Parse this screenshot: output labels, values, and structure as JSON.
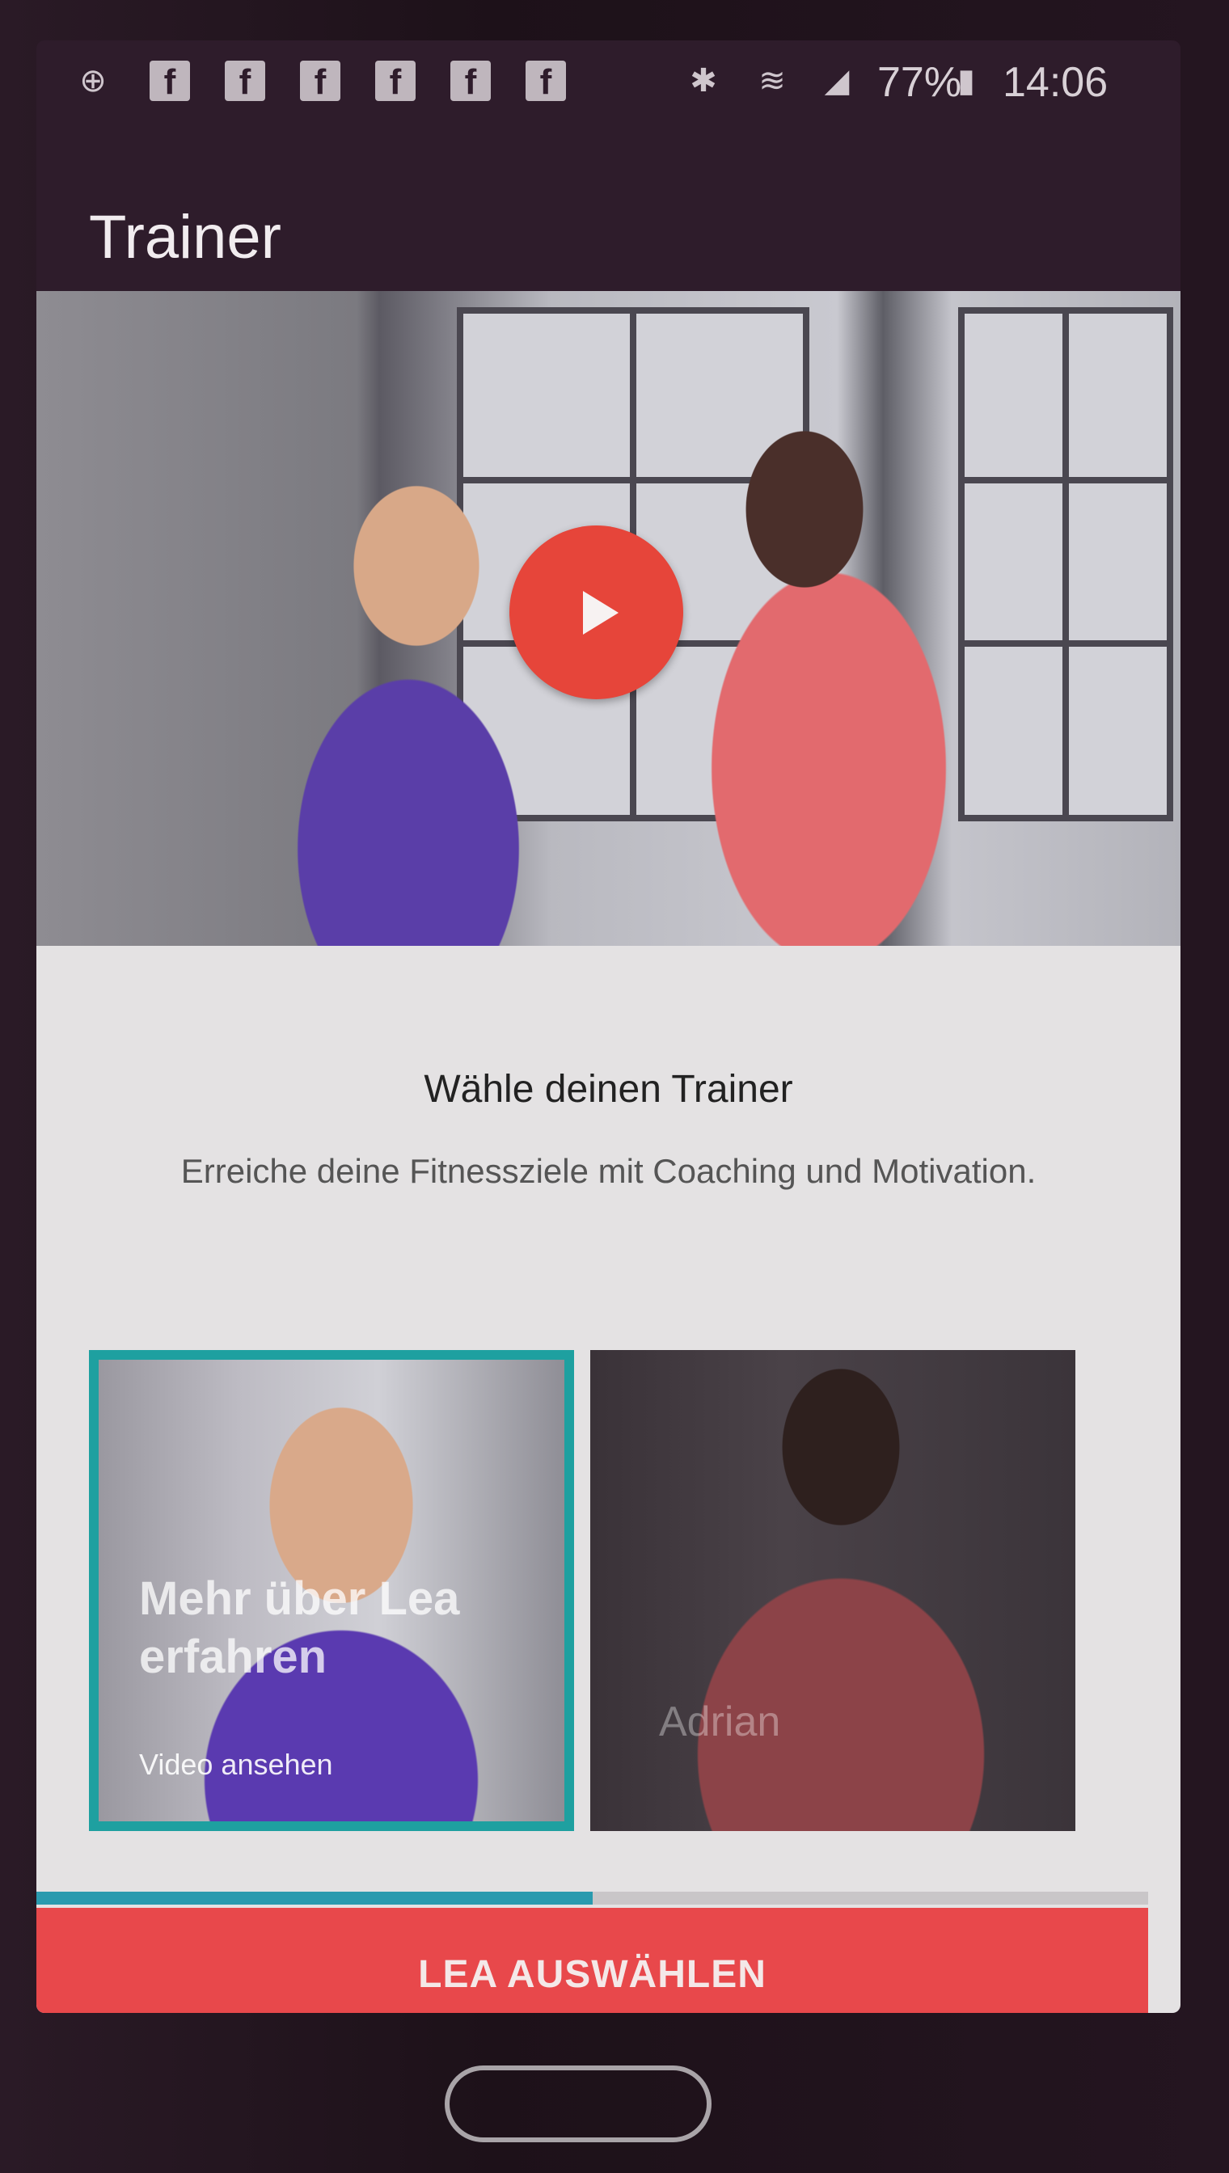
{
  "status_bar": {
    "battery": "77%",
    "time": "14:06",
    "icons": [
      "notification-icon",
      "facebook-icon",
      "facebook-icon",
      "facebook-icon",
      "facebook-icon",
      "facebook-icon",
      "facebook-icon",
      "bluetooth-icon",
      "wifi-icon",
      "signal-icon",
      "battery-icon"
    ]
  },
  "app_bar": {
    "title": "Trainer"
  },
  "hero": {
    "play_icon": "play-icon",
    "play_color": "#e6453a"
  },
  "content": {
    "headline": "Wähle deinen Trainer",
    "subline": "Erreiche deine Fitnessziele mit Coaching und Motivation."
  },
  "trainers": [
    {
      "title": "Mehr über Lea erfahren",
      "subtitle": "Video ansehen",
      "selected": true,
      "accent": "#1ea0a0"
    },
    {
      "name": "Adrian",
      "selected": false
    }
  ],
  "progress": {
    "fraction": 0.5,
    "color": "#2a9aae"
  },
  "cta": {
    "label": "LEA AUSWÄHLEN",
    "color": "#e8484b"
  }
}
